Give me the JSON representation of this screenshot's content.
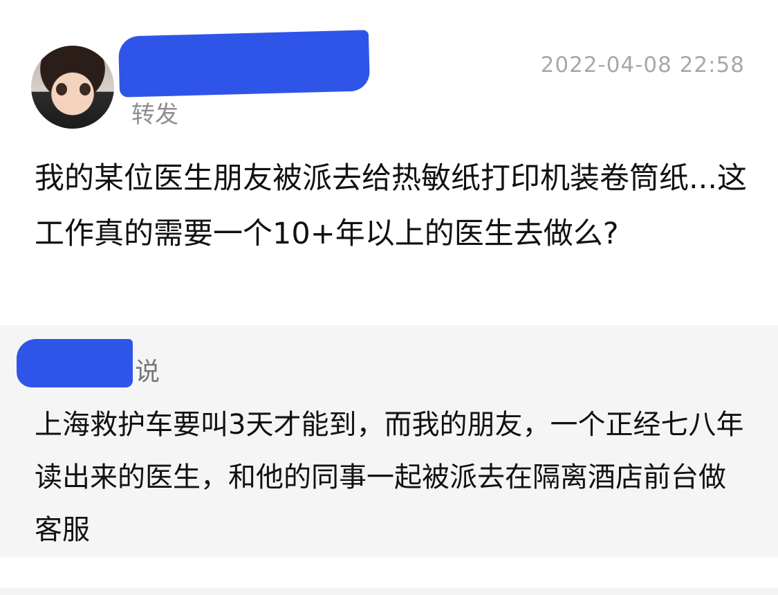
{
  "post": {
    "timestamp": "2022-04-08 22:58",
    "action": "转发",
    "text": "我的某位医生朋友被派去给热敏纸打印机装卷筒纸...这工作真的需要一个10+年以上的医生去做么?"
  },
  "quote": {
    "said_label": "说",
    "text": "上海救护车要叫3天才能到，而我的朋友，一个正经七八年读出来的医生，和他的同事一起被派去在隔离酒店前台做客服"
  },
  "colors": {
    "redaction": "#2f55e8",
    "quote_background": "#f5f5f5",
    "secondary_text": "#8e8e8e"
  }
}
